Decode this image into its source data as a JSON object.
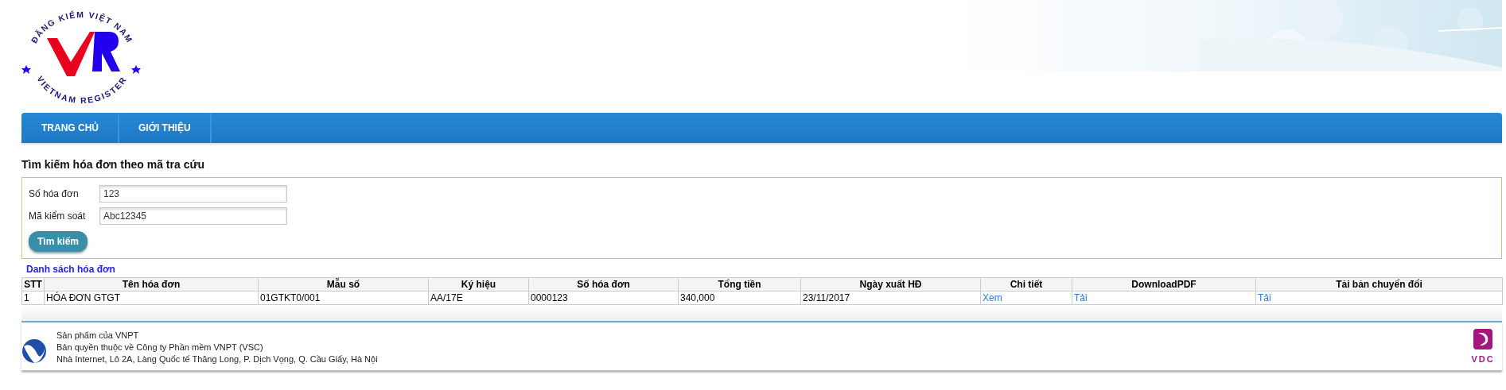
{
  "logo": {
    "top_text": "ĐĂNG KIỂM VIỆT NAM",
    "bottom_text": "VIETNAM REGISTER"
  },
  "nav": [
    {
      "label": "TRANG CHỦ"
    },
    {
      "label": "GIỚI THIỆU"
    }
  ],
  "search": {
    "title": "Tìm kiếm hóa đơn theo mã tra cứu",
    "fields": [
      {
        "label": "Số hóa đơn",
        "value": "123"
      },
      {
        "label": "Mã kiểm soát",
        "value": "Abc12345"
      }
    ],
    "button": "Tìm kiếm"
  },
  "list_link": "Danh sách hóa đơn",
  "table": {
    "columns": [
      "STT",
      "Tên hóa đơn",
      "Mẫu số",
      "Ký hiệu",
      "Số hóa đơn",
      "Tổng tiền",
      "Ngày xuất HĐ",
      "Chi tiết",
      "DownloadPDF",
      "Tải bản chuyển đổi"
    ],
    "rows": [
      {
        "cells": [
          {
            "text": "1",
            "kind": "text"
          },
          {
            "text": "HÓA ĐƠN GTGT",
            "kind": "text"
          },
          {
            "text": "01GTKT0/001",
            "kind": "text"
          },
          {
            "text": "AA/17E",
            "kind": "text"
          },
          {
            "text": "0000123",
            "kind": "text"
          },
          {
            "text": "340,000",
            "kind": "text"
          },
          {
            "text": "23/11/2017",
            "kind": "text"
          },
          {
            "text": "Xem",
            "kind": "link"
          },
          {
            "text": "Tải",
            "kind": "link"
          },
          {
            "text": "Tải",
            "kind": "link"
          }
        ]
      }
    ]
  },
  "footer": {
    "lines": [
      "Sản phẩm của VNPT",
      "Bản quyền thuộc về Công ty Phần mềm VNPT (VSC)",
      "Nhà Internet, Lô 2A, Làng Quốc tế Thăng Long, P. Dịch Vọng, Q. Cầu Giấy, Hà Nội"
    ],
    "right_logo_text": "VDC"
  }
}
